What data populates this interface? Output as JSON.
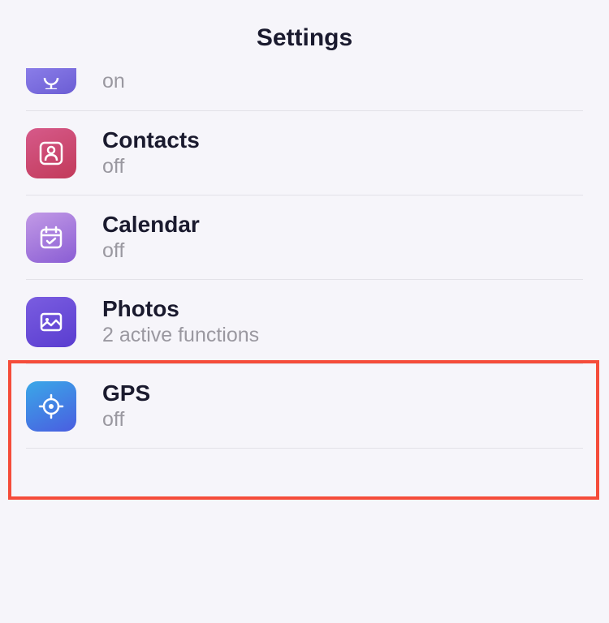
{
  "header": {
    "title": "Settings"
  },
  "rows": [
    {
      "icon": "mic-icon",
      "title": "",
      "sub": "on"
    },
    {
      "icon": "contact-icon",
      "title": "Contacts",
      "sub": "off"
    },
    {
      "icon": "calendar-icon",
      "title": "Calendar",
      "sub": "off"
    },
    {
      "icon": "photo-icon",
      "title": "Photos",
      "sub": "2 active functions"
    },
    {
      "icon": "gps-icon",
      "title": "GPS",
      "sub": "off"
    }
  ]
}
